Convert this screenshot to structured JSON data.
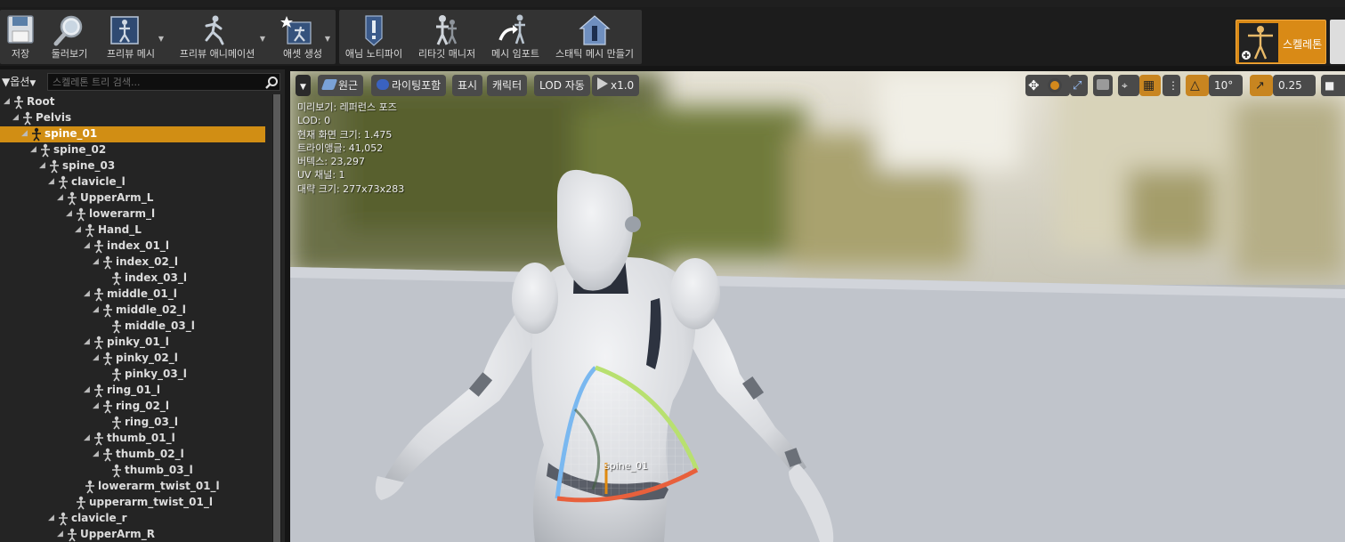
{
  "toolbar": {
    "save": "저장",
    "browse": "둘러보기",
    "preview_mesh": "프리뷰 메시",
    "preview_animation": "프리뷰 애니메이션",
    "create_asset": "애셋 생성",
    "anim_notify": "애님 노티파이",
    "retarget_manager": "리타깃 매니저",
    "import_mesh": "메시 임포트",
    "make_static_mesh": "스태틱 메시 만들기",
    "skeleton_mode": "스켈레톤"
  },
  "panel": {
    "options_label": "옵션",
    "search_placeholder": "스켈레톤 트리 검색..."
  },
  "bones": [
    {
      "name": "Root",
      "depth": 0
    },
    {
      "name": "Pelvis",
      "depth": 1
    },
    {
      "name": "spine_01",
      "depth": 2,
      "selected": true
    },
    {
      "name": "spine_02",
      "depth": 3
    },
    {
      "name": "spine_03",
      "depth": 4
    },
    {
      "name": "clavicle_l",
      "depth": 5
    },
    {
      "name": "UpperArm_L",
      "depth": 6
    },
    {
      "name": "lowerarm_l",
      "depth": 7
    },
    {
      "name": "Hand_L",
      "depth": 8
    },
    {
      "name": "index_01_l",
      "depth": 9
    },
    {
      "name": "index_02_l",
      "depth": 10
    },
    {
      "name": "index_03_l",
      "depth": 11,
      "leaf": true
    },
    {
      "name": "middle_01_l",
      "depth": 9
    },
    {
      "name": "middle_02_l",
      "depth": 10
    },
    {
      "name": "middle_03_l",
      "depth": 11,
      "leaf": true
    },
    {
      "name": "pinky_01_l",
      "depth": 9
    },
    {
      "name": "pinky_02_l",
      "depth": 10
    },
    {
      "name": "pinky_03_l",
      "depth": 11,
      "leaf": true
    },
    {
      "name": "ring_01_l",
      "depth": 9
    },
    {
      "name": "ring_02_l",
      "depth": 10
    },
    {
      "name": "ring_03_l",
      "depth": 11,
      "leaf": true
    },
    {
      "name": "thumb_01_l",
      "depth": 9
    },
    {
      "name": "thumb_02_l",
      "depth": 10
    },
    {
      "name": "thumb_03_l",
      "depth": 11,
      "leaf": true
    },
    {
      "name": "lowerarm_twist_01_l",
      "depth": 8,
      "leaf": true
    },
    {
      "name": "upperarm_twist_01_l",
      "depth": 7,
      "leaf": true
    },
    {
      "name": "clavicle_r",
      "depth": 5
    },
    {
      "name": "UpperArm_R",
      "depth": 6
    }
  ],
  "viewport": {
    "perspective": "원근",
    "lighting": "라이팅포함",
    "show": "표시",
    "character": "캐릭터",
    "lod": "LOD 자동",
    "play_speed": "x1.0",
    "rot_snap": "10°",
    "scale_snap": "0.25",
    "stats": [
      "미리보기: 레퍼런스 포즈",
      "LOD: 0",
      "현재 화면 크기: 1.475",
      "트라이앵글: 41,052",
      "버텍스: 23,297",
      "UV 채널: 1",
      "대략 크기: 277x73x283"
    ],
    "selected_bone_label": "spine_01"
  },
  "colors": {
    "selection": "#d18e14",
    "accent_orange": "#d98a16",
    "panel_bg": "#242424",
    "gizmo_red": "#e8603c",
    "gizmo_green": "#b8e070",
    "gizmo_blue": "#7ab8f0"
  }
}
